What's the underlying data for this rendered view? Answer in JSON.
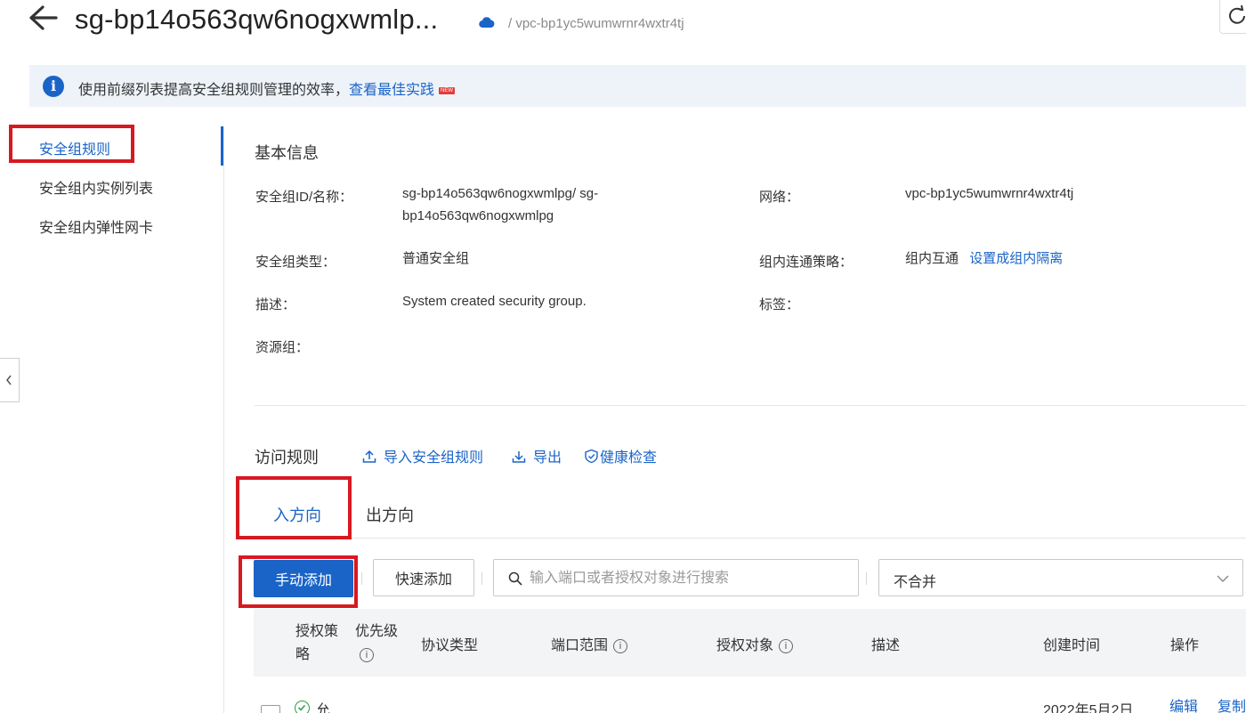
{
  "header": {
    "title": "sg-bp14o563qw6nogxwmlp...",
    "vpc_breadcrumb": "/ vpc-bp1yc5wumwrnr4wxtr4tj"
  },
  "notice": {
    "text": "使用前缀列表提高安全组规则管理的效率，",
    "link": "查看最佳实践",
    "badge": "NEW"
  },
  "nav": {
    "items": [
      {
        "label": "安全组规则",
        "active": true
      },
      {
        "label": "安全组内实例列表",
        "active": false
      },
      {
        "label": "安全组内弹性网卡",
        "active": false
      }
    ]
  },
  "basic_info": {
    "title": "基本信息",
    "fields": {
      "id_name": {
        "label": "安全组ID/名称：",
        "value": "sg-bp14o563qw6nogxwmlpg/ sg-bp14o563qw6nogxwmlpg"
      },
      "network": {
        "label": "网络：",
        "value": "vpc-bp1yc5wumwrnr4wxtr4tj"
      },
      "type": {
        "label": "安全组类型：",
        "value": "普通安全组"
      },
      "policy": {
        "label": "组内连通策略：",
        "value": "组内互通",
        "link": "设置成组内隔离"
      },
      "description": {
        "label": "描述：",
        "value": "System created security group."
      },
      "tags": {
        "label": "标签："
      },
      "resource_group": {
        "label": "资源组："
      }
    }
  },
  "rules": {
    "title": "访问规则",
    "actions": {
      "import": "导入安全组规则",
      "export": "导出",
      "health": "健康检查"
    },
    "tabs": [
      {
        "label": "入方向",
        "active": true
      },
      {
        "label": "出方向",
        "active": false
      }
    ],
    "toolbar": {
      "manual_add": "手动添加",
      "quick_add": "快速添加",
      "search_placeholder": "输入端口或者授权对象进行搜索",
      "merge_select": "不合并"
    },
    "table": {
      "headers": {
        "auth_policy": [
          "授权策",
          "略"
        ],
        "priority": "优先级",
        "protocol": "协议类型",
        "port_range": "端口范围",
        "auth_object": "授权对象",
        "description": "描述",
        "created_time": "创建时间",
        "actions": "操作"
      },
      "rows": [
        {
          "auth_policy": "允",
          "created_time": "2022年5月2日",
          "edit": "编辑",
          "copy": "复制"
        }
      ]
    }
  },
  "colors": {
    "primary": "#1a64c8",
    "highlight_box": "#d71920",
    "notice_bg": "#eef3fa"
  }
}
